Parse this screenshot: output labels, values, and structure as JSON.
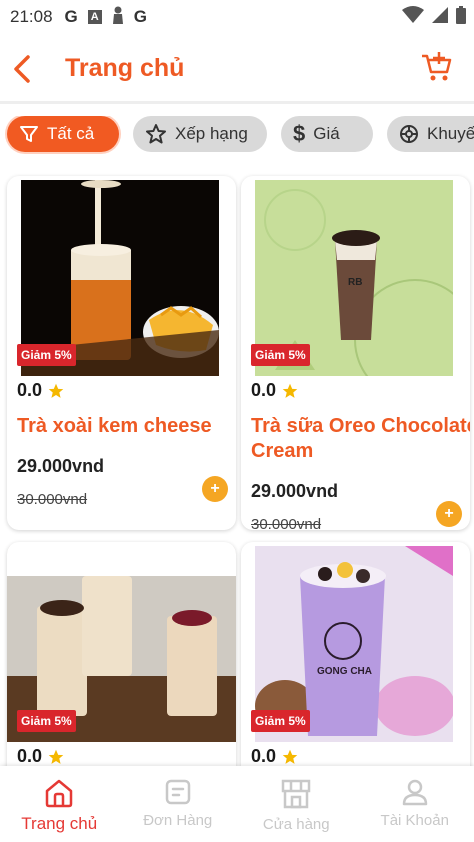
{
  "status_bar": {
    "time": "21:08",
    "icons_left": [
      "G",
      "A",
      "G"
    ]
  },
  "header": {
    "title": "Trang chủ"
  },
  "filters": [
    {
      "label": "Tất cả",
      "icon": "filter-icon",
      "active": true
    },
    {
      "label": "Xếp hạng",
      "icon": "star-icon",
      "active": false
    },
    {
      "label": "Giá",
      "icon": "dollar-icon",
      "active": false
    },
    {
      "label": "Khuyế",
      "icon": "discount-icon",
      "active": false
    }
  ],
  "products": [
    {
      "badge": "Giảm 5%",
      "rating": "0.0",
      "name": "Trà xoài kem cheese",
      "price": "29.000vnd",
      "old_price": "30.000vnd"
    },
    {
      "badge": "Giảm 5%",
      "rating": "0.0",
      "name": "Trà sữa Oreo Chocolate Cream",
      "price": "29.000vnd",
      "old_price": "30.000vnd"
    },
    {
      "badge": "Giảm 5%",
      "rating": "0.0"
    },
    {
      "badge": "Giảm 5%",
      "rating": "0.0"
    }
  ],
  "add_label": "+",
  "nav": [
    {
      "label": "Trang chủ",
      "icon": "home-icon",
      "active": true
    },
    {
      "label": "Đơn Hàng",
      "icon": "orders-icon",
      "active": false
    },
    {
      "label": "Cửa hàng",
      "icon": "store-icon",
      "active": false
    },
    {
      "label": "Tài Khoản",
      "icon": "account-icon",
      "active": false
    }
  ],
  "colors": {
    "accent": "#ee5a24",
    "badge": "#d9262c",
    "add_button": "#f5a623",
    "nav_active": "#e53935"
  }
}
